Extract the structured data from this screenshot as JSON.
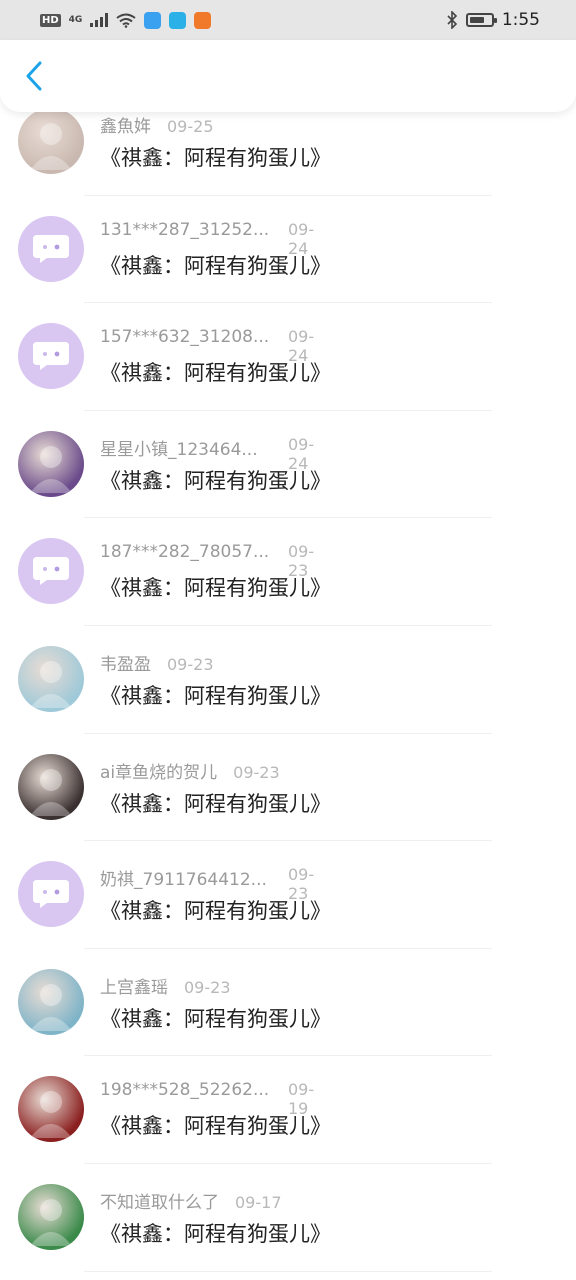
{
  "status_bar": {
    "hd": "HD",
    "network": "4G",
    "time": "1:55",
    "app_colors": [
      "#3aa0f0",
      "#2bb0e8",
      "#f07a2a"
    ]
  },
  "header": {
    "back_icon": "chevron-left-icon",
    "accent": "#1aa3e8"
  },
  "avatar_default_color": "#d9c7f2",
  "items": [
    {
      "name": "鑫魚姩",
      "date": "09-25",
      "title": "《祺鑫：阿程有狗蛋儿》",
      "avatar": "photo",
      "avatar_color": "#c9b8b0",
      "date_fixed": false
    },
    {
      "name": "131***287_31252...",
      "date": "09-24",
      "title": "《祺鑫：阿程有狗蛋儿》",
      "avatar": "default",
      "avatar_color": "#d9c7f2",
      "date_fixed": true
    },
    {
      "name": "157***632_31208...",
      "date": "09-24",
      "title": "《祺鑫：阿程有狗蛋儿》",
      "avatar": "default",
      "avatar_color": "#d9c7f2",
      "date_fixed": true
    },
    {
      "name": "星星小镇_123464...",
      "date": "09-24",
      "title": "《祺鑫：阿程有狗蛋儿》",
      "avatar": "photo",
      "avatar_color": "#6a4a8a",
      "date_fixed": true
    },
    {
      "name": "187***282_78057...",
      "date": "09-23",
      "title": "《祺鑫：阿程有狗蛋儿》",
      "avatar": "default",
      "avatar_color": "#d9c7f2",
      "date_fixed": true
    },
    {
      "name": "韦盈盈",
      "date": "09-23",
      "title": "《祺鑫：阿程有狗蛋儿》",
      "avatar": "photo",
      "avatar_color": "#9fc9d8",
      "date_fixed": false
    },
    {
      "name": "ai章鱼烧的贺儿",
      "date": "09-23",
      "title": "《祺鑫：阿程有狗蛋儿》",
      "avatar": "photo",
      "avatar_color": "#3a3030",
      "date_fixed": false
    },
    {
      "name": "奶祺_7911764412...",
      "date": "09-23",
      "title": "《祺鑫：阿程有狗蛋儿》",
      "avatar": "default",
      "avatar_color": "#d9c7f2",
      "date_fixed": true
    },
    {
      "name": "上宫鑫瑶",
      "date": "09-23",
      "title": "《祺鑫：阿程有狗蛋儿》",
      "avatar": "photo",
      "avatar_color": "#7fb4c8",
      "date_fixed": false
    },
    {
      "name": "198***528_52262...",
      "date": "09-19",
      "title": "《祺鑫：阿程有狗蛋儿》",
      "avatar": "photo",
      "avatar_color": "#8a1f1f",
      "date_fixed": true
    },
    {
      "name": "不知道取什么了",
      "date": "09-17",
      "title": "《祺鑫：阿程有狗蛋儿》",
      "avatar": "photo",
      "avatar_color": "#3a8a4a",
      "date_fixed": false
    }
  ]
}
